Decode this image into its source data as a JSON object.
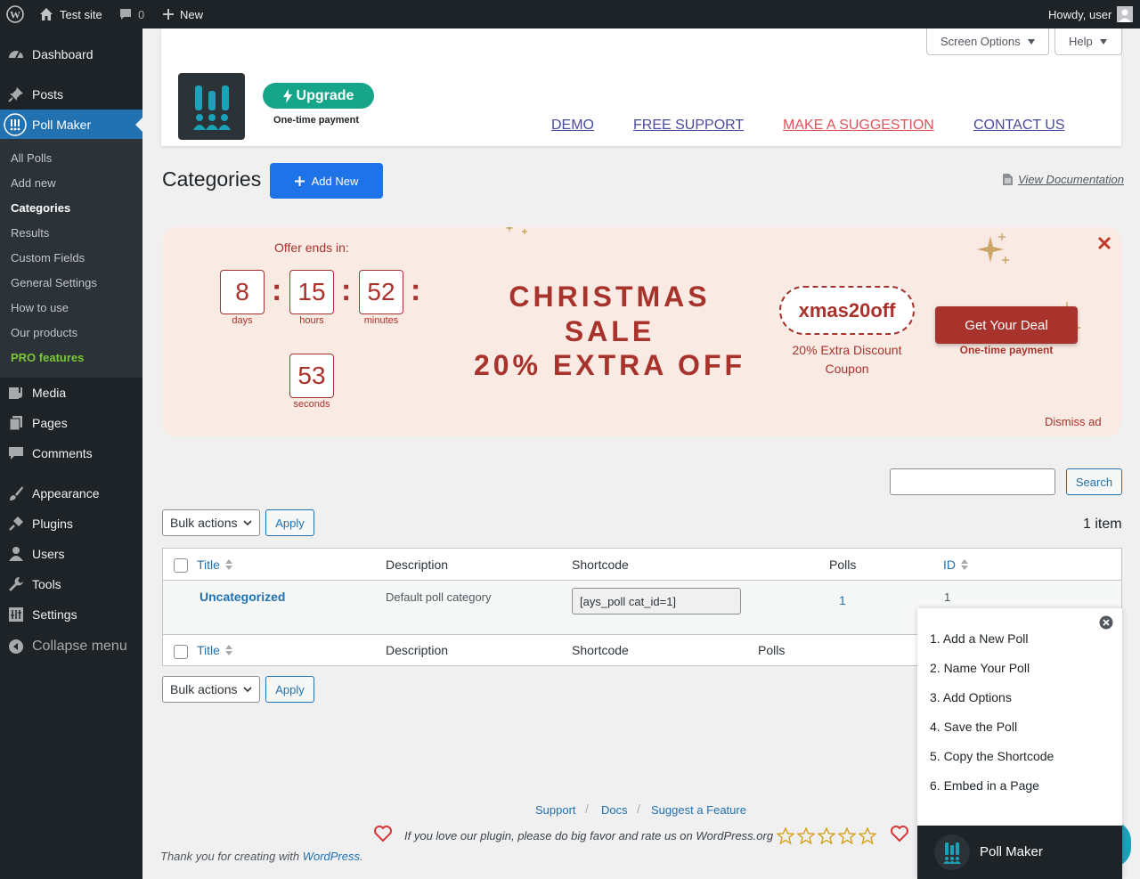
{
  "adminbar": {
    "site": "Test site",
    "comments": "0",
    "new": "New",
    "howdy": "Howdy, user"
  },
  "sidebar": {
    "items": [
      {
        "label": "Dashboard",
        "icon": "dashboard-icon"
      },
      {
        "label": "Posts",
        "icon": "pin-icon"
      },
      {
        "label": "Poll Maker",
        "icon": "poll-maker-icon"
      },
      {
        "label": "Media",
        "icon": "media-icon"
      },
      {
        "label": "Pages",
        "icon": "pages-icon"
      },
      {
        "label": "Comments",
        "icon": "comment-icon"
      },
      {
        "label": "Appearance",
        "icon": "brush-icon"
      },
      {
        "label": "Plugins",
        "icon": "plugin-icon"
      },
      {
        "label": "Users",
        "icon": "user-icon"
      },
      {
        "label": "Tools",
        "icon": "wrench-icon"
      },
      {
        "label": "Settings",
        "icon": "settings-icon"
      },
      {
        "label": "Collapse menu",
        "icon": "collapse-icon"
      }
    ],
    "submenu": [
      "All Polls",
      "Add new",
      "Categories",
      "Results",
      "Custom Fields",
      "General Settings",
      "How to use",
      "Our products",
      "PRO features"
    ]
  },
  "header": {
    "screen_options": "Screen Options",
    "help": "Help",
    "upgrade": "Upgrade",
    "one_time": "One-time payment",
    "links": [
      "DEMO",
      "FREE SUPPORT",
      "MAKE A SUGGESTION",
      "CONTACT US"
    ]
  },
  "page": {
    "title": "Categories",
    "add_new": "Add New",
    "view_docs": "View Documentation"
  },
  "sale": {
    "offer_ends": "Offer ends in:",
    "countdown": [
      {
        "value": "8",
        "unit": "days"
      },
      {
        "value": "15",
        "unit": "hours"
      },
      {
        "value": "52",
        "unit": "minutes"
      },
      {
        "value": "53",
        "unit": "seconds"
      }
    ],
    "title_lines": [
      "CHRISTMAS",
      "SALE",
      "20% EXTRA OFF"
    ],
    "coupon": "xmas20off",
    "coupon_note": "20% Extra Discount Coupon",
    "cta": "Get Your Deal",
    "cta_note": "One-time payment",
    "dismiss": "Dismiss ad"
  },
  "search": {
    "button": "Search",
    "value": ""
  },
  "toolbar": {
    "bulk": "Bulk actions",
    "apply": "Apply",
    "count": "1 item"
  },
  "table": {
    "columns": {
      "title": "Title",
      "description": "Description",
      "shortcode": "Shortcode",
      "polls": "Polls",
      "id": "ID"
    },
    "rows": [
      {
        "title": "Uncategorized",
        "description": "Default poll category",
        "shortcode": "[ays_poll cat_id=1]",
        "polls": "1",
        "id": "1"
      }
    ]
  },
  "footer": {
    "links": [
      "Support",
      "Docs",
      "Suggest a Feature"
    ],
    "love": "If you love our plugin, please do big favor and rate us on WordPress.org",
    "thanks": "Thank you for creating with ",
    "wp": "WordPress",
    "period": "."
  },
  "popup": {
    "steps": [
      "1. Add a New Poll",
      "2. Name Your Poll",
      "3. Add Options",
      "4. Save the Poll",
      "5. Copy the Shortcode",
      "6. Embed in a Page"
    ],
    "brand": "Poll Maker"
  },
  "colors": {
    "wp_blue": "#2271b1",
    "sale_red": "#a8322c",
    "upgrade_green": "#17a589",
    "dark": "#1d2327"
  }
}
